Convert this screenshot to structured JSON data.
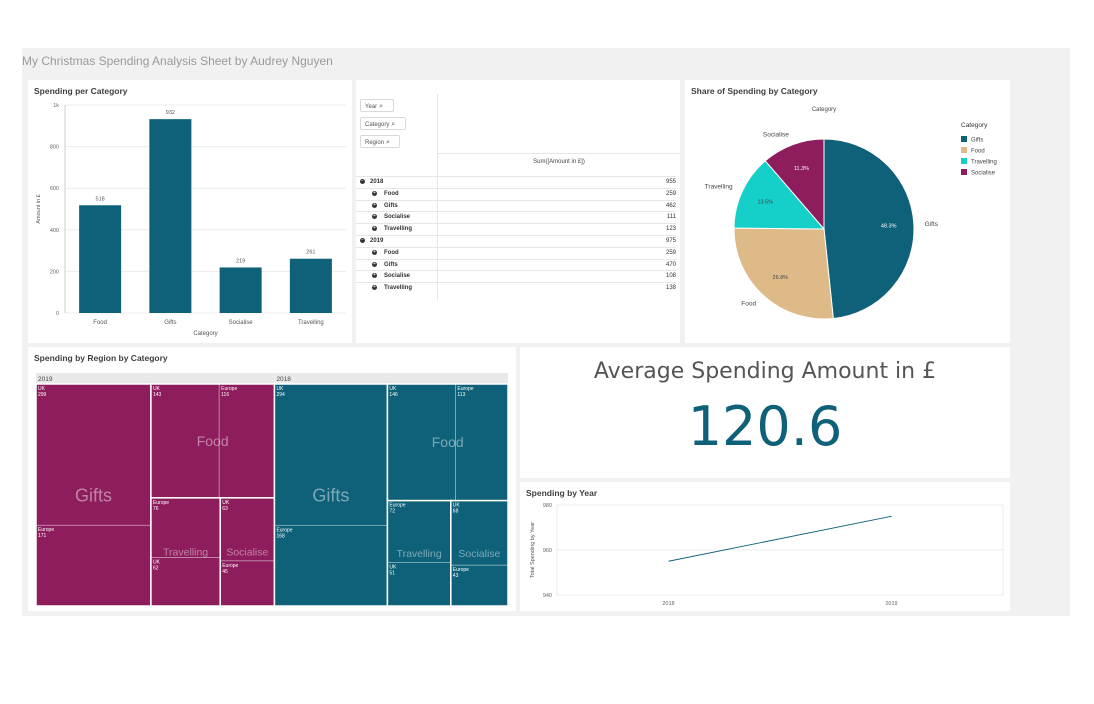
{
  "sheet_title": "My Christmas Spending Analysis Sheet by Audrey Nguyen",
  "colors": {
    "teal": "#0e6178",
    "purple": "#8d1d5c",
    "tan": "#deba88",
    "cyan": "#15cfc9",
    "ink": "#404040"
  },
  "bar_panel": {
    "title": "Spending per Category"
  },
  "pivot": {
    "filters": [
      "Year",
      "Category",
      "Region"
    ],
    "measure_header": "Sum([Amount in £])",
    "rows": [
      {
        "label": "2018",
        "value": "955",
        "level": 0,
        "icon": "minus"
      },
      {
        "label": "Food",
        "value": "259",
        "level": 1,
        "icon": "plus"
      },
      {
        "label": "Gifts",
        "value": "462",
        "level": 1,
        "icon": "plus"
      },
      {
        "label": "Socialise",
        "value": "111",
        "level": 1,
        "icon": "plus"
      },
      {
        "label": "Travelling",
        "value": "123",
        "level": 1,
        "icon": "plus"
      },
      {
        "label": "2019",
        "value": "975",
        "level": 0,
        "icon": "minus"
      },
      {
        "label": "Food",
        "value": "259",
        "level": 1,
        "icon": "plus"
      },
      {
        "label": "Gifts",
        "value": "470",
        "level": 1,
        "icon": "plus"
      },
      {
        "label": "Socialise",
        "value": "108",
        "level": 1,
        "icon": "plus"
      },
      {
        "label": "Travelling",
        "value": "138",
        "level": 1,
        "icon": "plus"
      }
    ]
  },
  "pie_panel": {
    "title": "Share of Spending by Category",
    "subtitle": "Category"
  },
  "treemap_panel": {
    "title": "Spending by Region by Category",
    "years": [
      "2019",
      "2018"
    ]
  },
  "kpi": {
    "title": "Average Spending Amount in £",
    "value": "120.6"
  },
  "line_panel": {
    "title": "Spending by Year"
  },
  "chart_data": [
    {
      "type": "bar",
      "categories": [
        "Food",
        "Gifts",
        "Socialise",
        "Travelling"
      ],
      "values": [
        518,
        932,
        219,
        261
      ],
      "data_labels": [
        "518",
        "932",
        "219",
        "261"
      ],
      "xlabel": "Category",
      "ylabel": "Amount in £",
      "ylim": [
        0,
        1000
      ],
      "yticks": [
        0,
        200,
        400,
        600,
        800,
        1000
      ],
      "ytick_labels": [
        "0",
        "200",
        "400",
        "600",
        "800",
        "1k"
      ],
      "grid": true,
      "color": "#0e6178"
    },
    {
      "type": "pie",
      "title": "Category",
      "legend_title": "Category",
      "legend_position": "right",
      "slices": [
        {
          "label": "Gifts",
          "value": 48.3,
          "pct_label": "48.3%",
          "color": "#0e6178"
        },
        {
          "label": "Food",
          "value": 26.8,
          "pct_label": "26.8%",
          "color": "#deba88"
        },
        {
          "label": "Travelling",
          "value": 13.5,
          "pct_label": "13.5%",
          "color": "#15cfc9"
        },
        {
          "label": "Socialise",
          "value": 11.3,
          "pct_label": "11.3%",
          "color": "#8d1d5c"
        }
      ]
    },
    {
      "type": "heatmap",
      "title": "Spending by Region by Category",
      "groups": [
        {
          "year": "2019",
          "color": "#8d1d5c",
          "categories": [
            {
              "name": "Gifts",
              "cells": [
                {
                  "region": "UK",
                  "value": 299
                },
                {
                  "region": "Europe",
                  "value": 171
                }
              ]
            },
            {
              "name": "Food",
              "cells": [
                {
                  "region": "UK",
                  "value": 143
                },
                {
                  "region": "Europe",
                  "value": 116
                }
              ]
            },
            {
              "name": "Travelling",
              "cells": [
                {
                  "region": "Europe",
                  "value": 76
                },
                {
                  "region": "UK",
                  "value": 62
                }
              ]
            },
            {
              "name": "Socialise",
              "cells": [
                {
                  "region": "UK",
                  "value": 63
                },
                {
                  "region": "Europe",
                  "value": 45
                }
              ]
            }
          ]
        },
        {
          "year": "2018",
          "color": "#0e6178",
          "categories": [
            {
              "name": "Gifts",
              "cells": [
                {
                  "region": "UK",
                  "value": 294
                },
                {
                  "region": "Europe",
                  "value": 168
                }
              ]
            },
            {
              "name": "Food",
              "cells": [
                {
                  "region": "UK",
                  "value": 146
                },
                {
                  "region": "Europe",
                  "value": 113
                }
              ]
            },
            {
              "name": "Travelling",
              "cells": [
                {
                  "region": "Europe",
                  "value": 72
                },
                {
                  "region": "UK",
                  "value": 51
                }
              ]
            },
            {
              "name": "Socialise",
              "cells": [
                {
                  "region": "UK",
                  "value": 68
                },
                {
                  "region": "Europe",
                  "value": 43
                }
              ]
            }
          ]
        }
      ]
    },
    {
      "type": "line",
      "x": [
        "2018",
        "2019"
      ],
      "values": [
        955,
        975
      ],
      "ylabel": "Total Spending by Year",
      "ylim": [
        940,
        980
      ],
      "yticks": [
        940,
        960,
        980
      ],
      "grid": true,
      "color": "#0e6178"
    }
  ]
}
